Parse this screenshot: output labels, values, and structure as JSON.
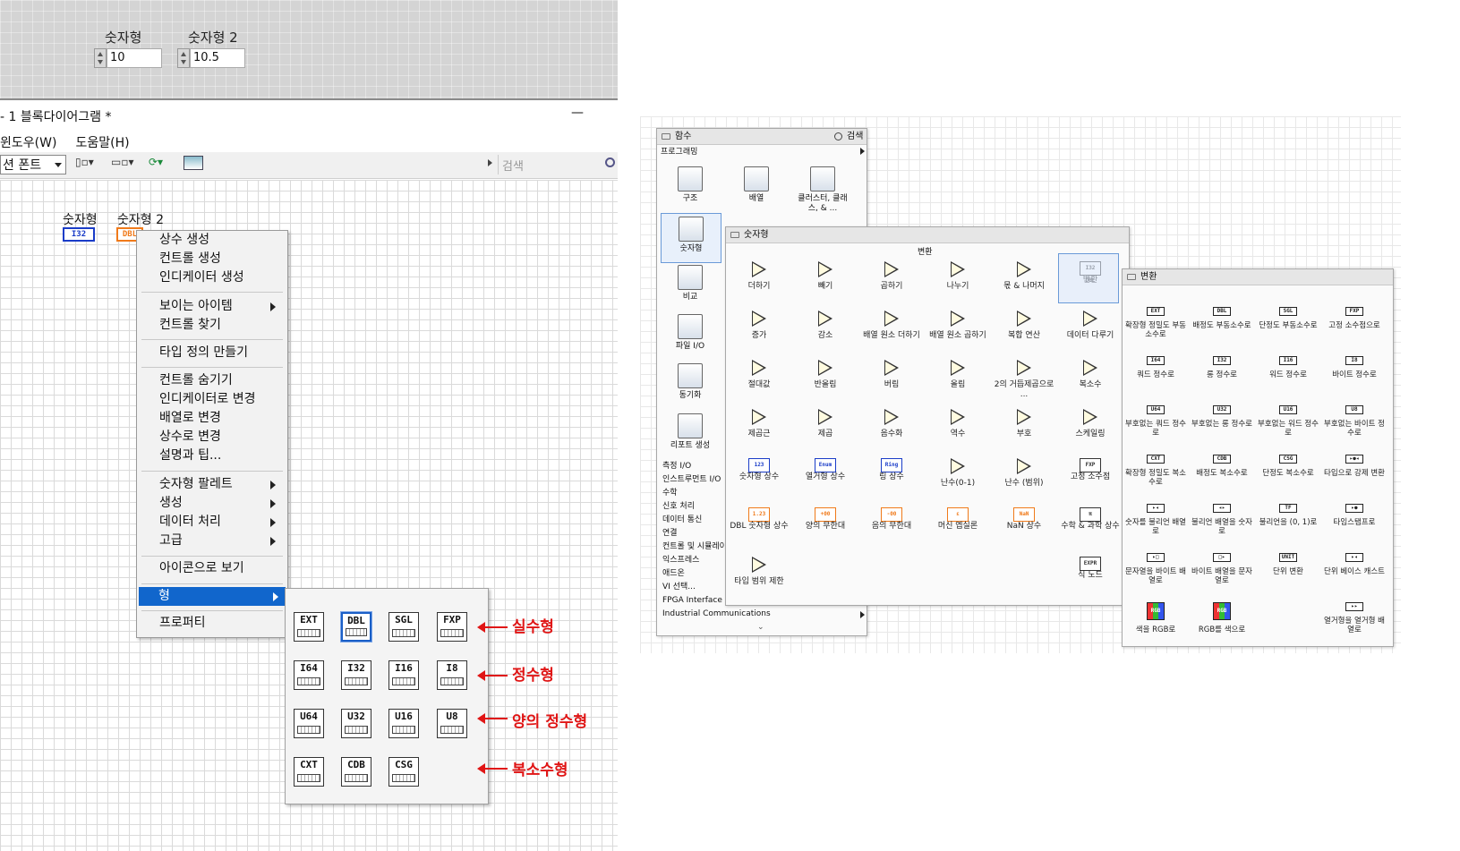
{
  "front_panel": {
    "controls": [
      {
        "label": "숫자형",
        "value": "10"
      },
      {
        "label": "숫자형 2",
        "value": "10.5"
      }
    ]
  },
  "block_diagram": {
    "title": "1 블록다이어그램 *",
    "minimize": "—",
    "menu": [
      "윈도우(W)",
      "도움말(H)"
    ],
    "font_select": "션 폰트",
    "search_placeholder": "검색",
    "terminals": [
      {
        "label": "숫자형",
        "type": "I32",
        "color": "#1a3cc8"
      },
      {
        "label": "숫자형 2",
        "type": "DBL",
        "color": "#f07a1a"
      }
    ]
  },
  "context_menu": {
    "items": [
      {
        "label": "상수 생성",
        "submenu": false
      },
      {
        "label": "컨트롤 생성",
        "submenu": false
      },
      {
        "label": "인디케이터 생성",
        "submenu": false
      },
      {
        "label": "보이는 아이템",
        "submenu": true
      },
      {
        "label": "컨트롤 찾기",
        "submenu": false
      },
      {
        "label": "타입 정의 만들기",
        "submenu": false
      },
      {
        "label": "컨트롤 숨기기",
        "submenu": false
      },
      {
        "label": "인디케이터로 변경",
        "submenu": false
      },
      {
        "label": "배열로 변경",
        "submenu": false
      },
      {
        "label": "상수로 변경",
        "submenu": false
      },
      {
        "label": "설명과 팁...",
        "submenu": false
      },
      {
        "label": "숫자형 팔레트",
        "submenu": true
      },
      {
        "label": "생성",
        "submenu": true
      },
      {
        "label": "데이터 처리",
        "submenu": true
      },
      {
        "label": "고급",
        "submenu": true
      },
      {
        "label": "아이콘으로 보기",
        "submenu": false
      },
      {
        "label": "형",
        "submenu": true,
        "selected": true
      },
      {
        "label": "프로퍼티",
        "submenu": false
      }
    ]
  },
  "type_submenu": {
    "rows": [
      {
        "types": [
          "EXT",
          "DBL",
          "SGL",
          "FXP"
        ],
        "annotation": "실수형"
      },
      {
        "types": [
          "I64",
          "I32",
          "I16",
          "I8"
        ],
        "annotation": "정수형"
      },
      {
        "types": [
          "U64",
          "U32",
          "U16",
          "U8"
        ],
        "annotation": "양의 정수형"
      },
      {
        "types": [
          "CXT",
          "CDB",
          "CSG"
        ],
        "annotation": "복소수형"
      }
    ],
    "selected": "DBL",
    "annotation_color": "#e01515"
  },
  "functions_palette": {
    "title": "함수",
    "search_label": "검색",
    "section": "프로그래밍",
    "categories": [
      "구조",
      "배열",
      "클러스터, 클래스, & ...",
      "숫자형",
      "비교",
      "파일 I/O",
      "동기화",
      "리포트 생성"
    ],
    "side_list": [
      "측정 I/O",
      "인스트루먼트 I/O",
      "수학",
      "신호 처리",
      "데이터 통신",
      "연결",
      "컨트롤 및 시뮬레이",
      "익스프레스",
      "애드온",
      "VI 선택...",
      "FPGA Interface",
      "Industrial Communications"
    ]
  },
  "numeric_palette": {
    "title": "숫자형",
    "subheader": "변환",
    "items": [
      "더하기",
      "빼기",
      "곱하기",
      "나누기",
      "몫 & 나머지",
      "변환",
      "증가",
      "감소",
      "배열 원소 더하기",
      "배열 원소 곱하기",
      "복합 연산",
      "데이터 다루기",
      "절대값",
      "반올림",
      "버림",
      "올림",
      "2의 거듭제곱으로 ...",
      "복소수",
      "제곱근",
      "제곱",
      "음수화",
      "역수",
      "부호",
      "스케일링",
      "숫자형 상수",
      "열거형 상수",
      "링 상수",
      "난수(0-1)",
      "난수 (범위)",
      "고정 소수점",
      "DBL 숫자형 상수",
      "양의 무한대",
      "음의 무한대",
      "머신 엡실론",
      "NaN 상수",
      "수학 & 과학 상수",
      "타입 범위 제한",
      "",
      "",
      "",
      "",
      "식 노드"
    ],
    "icon_tags": [
      "",
      "",
      "",
      "",
      "",
      "I32 DBL",
      "",
      "",
      "",
      "",
      "",
      "",
      "",
      "",
      "",
      "",
      "",
      "",
      "",
      "",
      "",
      "",
      "",
      "",
      "123",
      "Enum",
      "Ring",
      "",
      "",
      "FXP",
      "1.23",
      "+00",
      "-00",
      "ε",
      "NaN",
      "π",
      "",
      "",
      "",
      "",
      "",
      "EXPR"
    ]
  },
  "conversion_palette": {
    "title": "변환",
    "items": [
      {
        "tag": "EXT",
        "label": "확장형 정밀도 부동소수로"
      },
      {
        "tag": "DBL",
        "label": "배정도 부동소수로"
      },
      {
        "tag": "SGL",
        "label": "단정도 부동소수로"
      },
      {
        "tag": "FXP",
        "label": "고정 소수점으로"
      },
      {
        "tag": "I64",
        "label": "쿼드 정수로"
      },
      {
        "tag": "I32",
        "label": "롱 정수로"
      },
      {
        "tag": "I16",
        "label": "워드 정수로"
      },
      {
        "tag": "I8",
        "label": "바이트 정수로"
      },
      {
        "tag": "U64",
        "label": "부호없는 쿼드 정수로"
      },
      {
        "tag": "U32",
        "label": "부호없는 롱 정수로"
      },
      {
        "tag": "U16",
        "label": "부호없는 워드 정수로"
      },
      {
        "tag": "U8",
        "label": "부호없는 바이트 정수로"
      },
      {
        "tag": "CXT",
        "label": "확장형 정밀도 복소수로"
      },
      {
        "tag": "CDB",
        "label": "배정도 복소수로"
      },
      {
        "tag": "CSG",
        "label": "단정도 복소수로"
      },
      {
        "tag": "▸●◂",
        "label": "타입으로 강제 변환"
      },
      {
        "tag": "▸◂",
        "label": "숫자를 불리언 배열로"
      },
      {
        "tag": "◂▸",
        "label": "불리언 배열을 숫자로"
      },
      {
        "tag": "TF",
        "label": "불리언을 (0, 1)로"
      },
      {
        "tag": "▸●",
        "label": "타임스탬프로"
      },
      {
        "tag": "▸□",
        "label": "문자열을 바이트 배열로"
      },
      {
        "tag": "□▸",
        "label": "바이트 배열을 문자열로"
      },
      {
        "tag": "UNIT",
        "label": "단위 변환"
      },
      {
        "tag": "▸◂",
        "label": "단위 베이스 캐스트"
      },
      {
        "tag": "RGB",
        "label": "색을 RGB로"
      },
      {
        "tag": "RGB",
        "label": "RGB를 색으로"
      },
      {
        "tag": "",
        "label": ""
      },
      {
        "tag": "▸▸",
        "label": "열거형을 열거형 배열로"
      }
    ]
  }
}
